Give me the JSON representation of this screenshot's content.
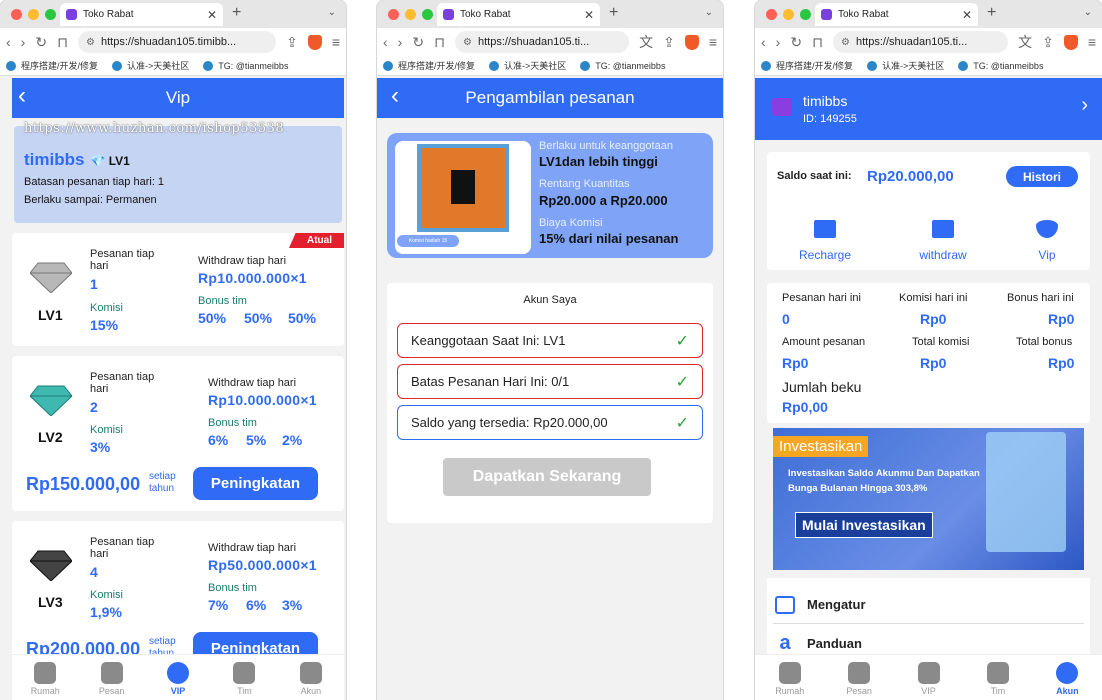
{
  "browser": {
    "tab_title": "Toko Rabat",
    "url_full": "https://shuadan105.timibb...",
    "url_short": "https://shuadan105.ti...",
    "bookmarks": [
      "程序搭建/开发/修复",
      "认准->天美社区",
      "TG: @tianmeibbs"
    ]
  },
  "vip": {
    "header": "Vip",
    "watermark": "https://www.huzhan.com/ishop53538",
    "user": "timibbs",
    "level": "LV1",
    "limit_line": "Batasan pesanan tiap hari: 1",
    "valid_line": "Berlaku sampai: Permanen",
    "current_badge": "Atual",
    "lbl_orders": "Pesanan tiap hari",
    "lbl_commission": "Komisi",
    "lbl_withdraw": "Withdraw tiap hari",
    "lbl_bonus": "Bonus tim",
    "lbl_per": "setiap tahun",
    "upgrade": "Peningkatan",
    "levels": [
      {
        "name": "LV1",
        "orders": "1",
        "commission": "15%",
        "withdraw": "Rp10.000.000×1",
        "bonus": [
          "50%",
          "50%",
          "50%"
        ],
        "gem_color": "#b8b8b8"
      },
      {
        "name": "LV2",
        "orders": "2",
        "commission": "3%",
        "withdraw": "Rp10.000.000×1",
        "bonus": [
          "6%",
          "5%",
          "2%"
        ],
        "price": "Rp150.000,00",
        "gem_color": "#3fb8b0"
      },
      {
        "name": "LV3",
        "orders": "4",
        "commission": "1,9%",
        "withdraw": "Rp50.000.000×1",
        "bonus": [
          "7%",
          "6%",
          "3%"
        ],
        "price": "Rp200.000,00",
        "gem_color": "#444444"
      }
    ]
  },
  "nav": {
    "items": [
      "Rumah",
      "Pesan",
      "VIP",
      "Tim",
      "Akun"
    ]
  },
  "order": {
    "header": "Pengambilan pesanan",
    "img_caption": "Komisi hadiah 15",
    "l1": "Berlaku untuk keanggotaan",
    "v1": "LV1dan lebih tinggi",
    "l2": "Rentang Kuantitas",
    "v2": "Rp20.000 a Rp20.000",
    "l3": "Biaya Komisi",
    "v3": "15% dari nilai pesanan",
    "account_title": "Akun Saya",
    "checks": [
      "Keanggotaan Saat Ini: LV1",
      "Batas Pesanan Hari Ini: 0/1",
      "Saldo yang tersedia: Rp20.000,00"
    ],
    "get_btn": "Dapatkan Sekarang"
  },
  "account": {
    "username": "timibbs",
    "id": "ID: 149255",
    "balance_label": "Saldo saat ini:",
    "balance": "Rp20.000,00",
    "history": "Histori",
    "actions": [
      "Recharge",
      "withdraw",
      "Vip"
    ],
    "stats": [
      {
        "label": "Pesanan hari ini",
        "value": "0"
      },
      {
        "label": "Komisi hari ini",
        "value": "Rp0"
      },
      {
        "label": "Bonus hari ini",
        "value": "Rp0"
      },
      {
        "label": "Amount pesanan",
        "value": "Rp0"
      },
      {
        "label": "Total komisi",
        "value": "Rp0"
      },
      {
        "label": "Total bonus",
        "value": "Rp0"
      }
    ],
    "frozen_label": "Jumlah beku",
    "frozen_value": "Rp0,00",
    "banner_tag": "Investasikan",
    "banner_text": "Investasikan Saldo Akunmu Dan Dapatkan Bunga Bulanan Hingga 303,8%",
    "banner_btn": "Mulai Investasikan",
    "menu": [
      "Mengatur",
      "Panduan"
    ]
  }
}
